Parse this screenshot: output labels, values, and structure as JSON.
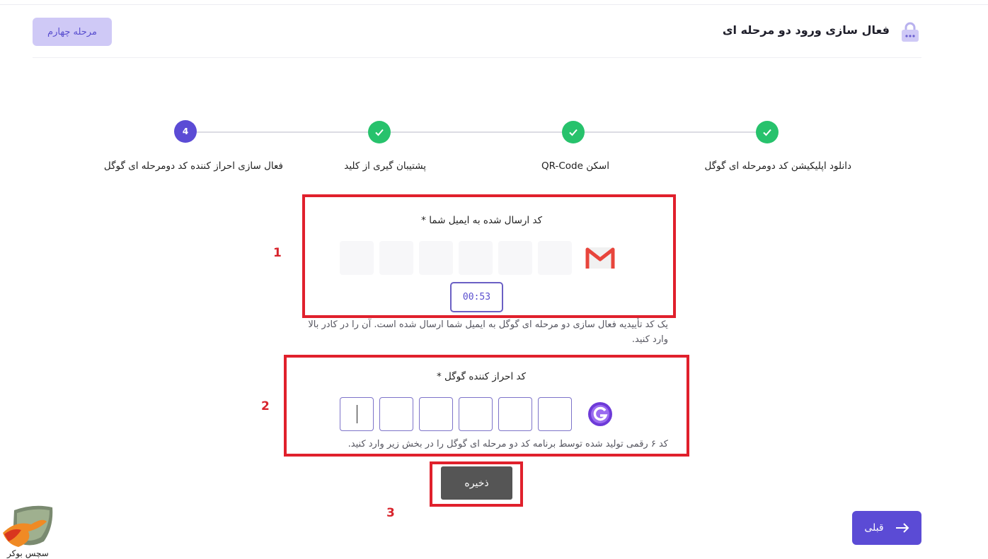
{
  "header": {
    "title": "فعال سازی ورود دو مرحله ای",
    "stage_badge": "مرحله چهارم",
    "icon": "lock-icon"
  },
  "stepper": {
    "steps": [
      {
        "label": "دانلود اپلیکیشن کد دومرحله ای گوگل",
        "status": "done",
        "marker": ""
      },
      {
        "label": "اسکن QR-Code",
        "status": "done",
        "marker": ""
      },
      {
        "label": "پشتیبان گیری از کلید",
        "status": "done",
        "marker": ""
      },
      {
        "label": "فعال سازی احراز کننده کد دومرحله ای گوگل",
        "status": "active",
        "marker": "4"
      }
    ]
  },
  "email_code": {
    "label": "کد ارسال شده به ایمیل شما *",
    "timer": "00:53",
    "help": "یک کد تأییدیه فعال سازی دو مرحله ای گوگل به ایمیل شما ارسال شده است. آن را در کادر بالا وارد کنید.",
    "icon": "gmail-icon"
  },
  "google_code": {
    "label": "کد احراز کننده گوگل *",
    "help": "کد ۶ رقمی تولید شده توسط برنامه کد دو مرحله ای گوگل را در بخش زیر وارد کنید.",
    "icon": "google-authenticator-icon"
  },
  "annotations": [
    "1",
    "2",
    "3"
  ],
  "actions": {
    "save_label": "ذخیره",
    "prev_label": "قبلی"
  },
  "watermark": {
    "text": "سچس بوکر"
  },
  "colors": {
    "primary": "#5b4bd5",
    "success": "#27c26c",
    "annotation_red": "#e0202c",
    "save_button": "#555555"
  }
}
